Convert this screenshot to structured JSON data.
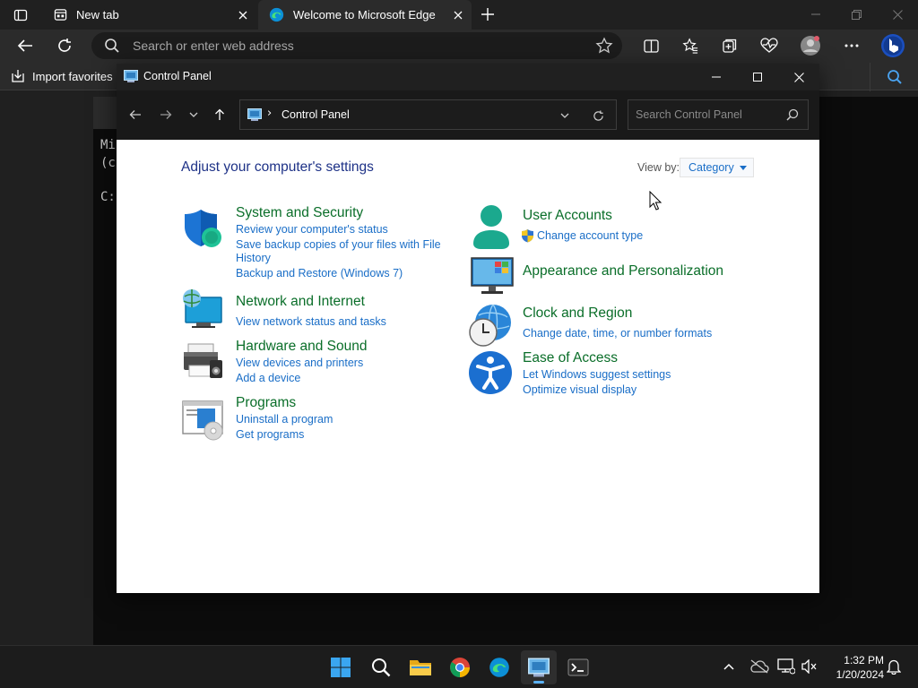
{
  "browser": {
    "tabs": [
      {
        "title": "New tab"
      },
      {
        "title": "Welcome to Microsoft Edge"
      }
    ],
    "address_placeholder": "Search or enter web address",
    "favorites_bar": {
      "import_label": "Import favorites"
    }
  },
  "terminal": {
    "lines": [
      "Mi",
      "(c",
      "",
      "C:"
    ]
  },
  "control_panel": {
    "window_title": "Control Panel",
    "location": "Control Panel",
    "search_placeholder": "Search Control Panel",
    "heading": "Adjust your computer's settings",
    "view_by_label": "View by:",
    "view_by_value": "Category",
    "categories": {
      "system_security": {
        "title": "System and Security",
        "links": [
          "Review your computer's status",
          "Save backup copies of your files with File History",
          "Backup and Restore (Windows 7)"
        ]
      },
      "network": {
        "title": "Network and Internet",
        "links": [
          "View network status and tasks"
        ]
      },
      "hardware": {
        "title": "Hardware and Sound",
        "links": [
          "View devices and printers",
          "Add a device"
        ]
      },
      "programs": {
        "title": "Programs",
        "links": [
          "Uninstall a program",
          "Get programs"
        ]
      },
      "user_accounts": {
        "title": "User Accounts",
        "links": [
          "Change account type"
        ]
      },
      "appearance": {
        "title": "Appearance and Personalization",
        "links": []
      },
      "clock_region": {
        "title": "Clock and Region",
        "links": [
          "Change date, time, or number formats"
        ]
      },
      "ease_access": {
        "title": "Ease of Access",
        "links": [
          "Let Windows suggest settings",
          "Optimize visual display"
        ]
      }
    }
  },
  "taskbar": {
    "time": "1:32 PM",
    "date": "1/20/2024"
  },
  "colors": {
    "link": "#1a6ec7",
    "category_title": "#0a6e29",
    "heading": "#1e3287",
    "accent": "#5bb2f5"
  }
}
